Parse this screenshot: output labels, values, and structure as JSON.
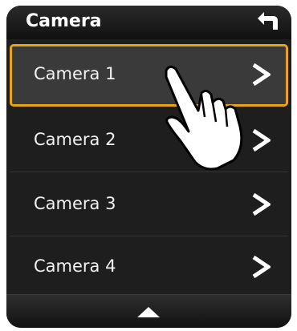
{
  "header": {
    "title": "Camera",
    "back_icon": "back-arrow-icon"
  },
  "list": {
    "items": [
      {
        "label": "Camera 1",
        "selected": true
      },
      {
        "label": "Camera 2",
        "selected": false
      },
      {
        "label": "Camera 3",
        "selected": false
      },
      {
        "label": "Camera 4",
        "selected": false
      }
    ]
  },
  "footer": {
    "up_icon": "chevron-up-icon"
  },
  "colors": {
    "selection_border": "#e6a419",
    "screen_bg": "#111111",
    "row_bg": "#1e1e1e",
    "selected_row_bg": "#3a3a3a",
    "text": "#f2f2f2"
  }
}
